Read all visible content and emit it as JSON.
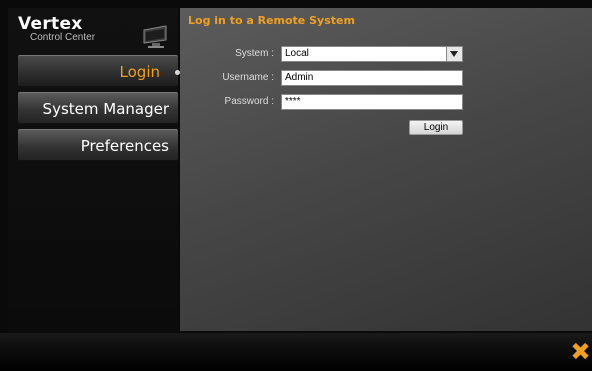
{
  "brand": {
    "title": "Vertex",
    "subtitle": "Control Center"
  },
  "nav": {
    "items": [
      {
        "label": "Login"
      },
      {
        "label": "System Manager"
      },
      {
        "label": "Preferences"
      }
    ]
  },
  "login_panel": {
    "title": "Log in to a Remote System",
    "system_label": "System :",
    "system_value": "Local",
    "username_label": "Username :",
    "username_value": "Admin",
    "password_label": "Password :",
    "password_value": "****",
    "login_button": "Login"
  },
  "colors": {
    "accent": "#f0a020",
    "panel": "#4a4a4a",
    "background": "#0a0a0a"
  },
  "icons": {
    "brand_icon": "monitor-icon",
    "close": "close-icon"
  }
}
